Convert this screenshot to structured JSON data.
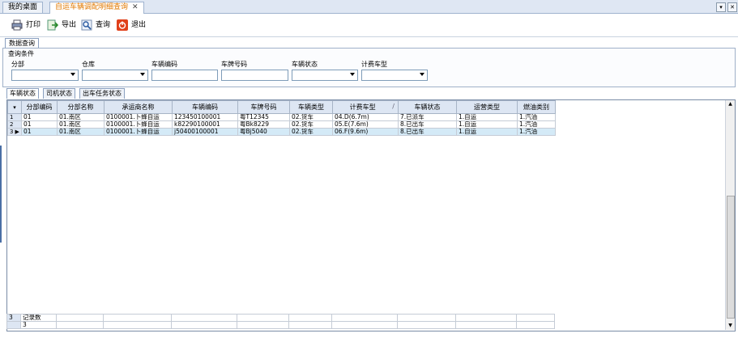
{
  "tabs": [
    {
      "label": "我的桌面"
    },
    {
      "label": "自运车辆调配明细查询",
      "close": "✕"
    }
  ],
  "window_buttons": {
    "dropdown": "▾",
    "close": "✕"
  },
  "toolbar": {
    "print": "打印",
    "export": "导出",
    "query": "查询",
    "exit": "退出"
  },
  "panel_tab": "数据查询",
  "query_legend": "查询条件",
  "filters": [
    {
      "label": "分部",
      "dropdown": true
    },
    {
      "label": "仓库",
      "dropdown": true
    },
    {
      "label": "车辆编码",
      "dropdown": false
    },
    {
      "label": "车牌号码",
      "dropdown": false
    },
    {
      "label": "车辆状态",
      "dropdown": true
    },
    {
      "label": "计费车型",
      "dropdown": true
    }
  ],
  "subtabs": [
    {
      "label": "车辆状态"
    },
    {
      "label": "司机状态"
    },
    {
      "label": "出车任务状态"
    }
  ],
  "grid": {
    "columns": [
      "分部编码",
      "分部名称",
      "承运商名称",
      "车辆编码",
      "车牌号码",
      "车辆类型",
      "计费车型",
      "车辆状态",
      "运营类型",
      "燃油类别"
    ],
    "rows": [
      {
        "n": "1",
        "c": [
          "01",
          "01.南区",
          "0100001.卜蜂自运",
          "123450100001",
          "粤T12345",
          "02.货车",
          "04.D(6.7m)",
          "7.已派车",
          "1.自运",
          "1.汽油"
        ]
      },
      {
        "n": "2",
        "c": [
          "01",
          "01.南区",
          "0100001.卜蜂自运",
          "k82290100001",
          "粤Bk8229",
          "02.货车",
          "05.E(7.6m)",
          "8.已出车",
          "1.自运",
          "1.汽油"
        ]
      },
      {
        "n": "3",
        "c": [
          "01",
          "01.南区",
          "0100001.卜蜂自运",
          "j50400100001",
          "粤Bj5040",
          "02.货车",
          "06.F(9.6m)",
          "8.已出车",
          "1.自运",
          "1.汽油"
        ]
      }
    ],
    "selected_row": 2
  },
  "footer": {
    "row_no": "3",
    "label": "记录数",
    "value": "3"
  }
}
